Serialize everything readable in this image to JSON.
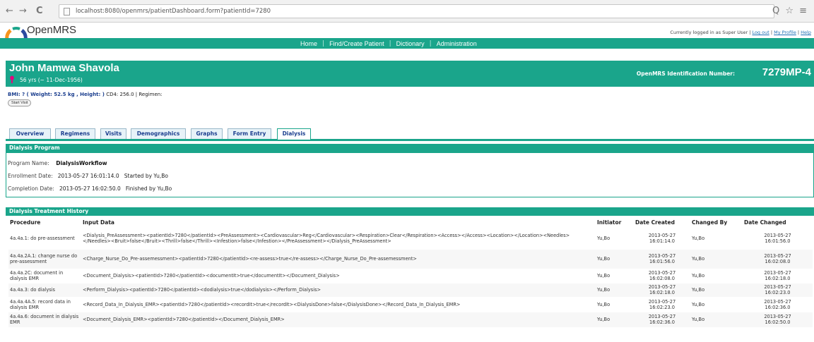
{
  "browser": {
    "url": "localhost:8080/openmrs/patientDashboard.form?patientId=7280",
    "back_glyph": "←",
    "forward_glyph": "→",
    "reload_glyph": "C",
    "right_glyphs": "Q ☆ ≡"
  },
  "app": {
    "logo_text": "OpenMRS",
    "user_prefix": "Currently logged in as Super User",
    "logout": "Log out",
    "my_profile": "My Profile",
    "help": "Help",
    "menu": [
      "Home",
      "Find/Create Patient",
      "Dictionary",
      "Administration"
    ],
    "menu_sep": "|",
    "accent": "#1aa58b"
  },
  "patient": {
    "name": "John Mamwa Shavola",
    "age": "56 yrs (~ 11-Dec-1956)",
    "id_label": "OpenMRS Identification Number:",
    "id_value": "7279MP-4",
    "bmi_label": "BMI: ?",
    "weight_height": "( Weight: 52.5 kg , Height: )",
    "cd4": "CD4: 256.0",
    "regimen": "| Regimen:",
    "start_visit": "Start Visit"
  },
  "tabs": [
    "Overview",
    "Regimens",
    "Visits",
    "Demographics",
    "Graphs",
    "Form Entry",
    "Dialysis"
  ],
  "program": {
    "title": "Dialysis Program",
    "name_label": "Program Name:",
    "name_value": "DialysisWorkflow",
    "enroll_label": "Enrollment Date:",
    "enroll_value": "2013-05-27 16:01:14.0",
    "enroll_by": "Started by Yu,Bo",
    "complete_label": "Completion Date:",
    "complete_value": "2013-05-27 16:02:50.0",
    "complete_by": "Finished by Yu,Bo"
  },
  "history": {
    "title": "Dialysis Treatment History",
    "columns": [
      "Procedure",
      "Input Data",
      "Initiator",
      "Date Created",
      "Changed By",
      "Date Changed"
    ],
    "rows": [
      {
        "procedure": "4a.4a.1: do pre-assessment",
        "input": "<Dialysis_PreAssessment><patientId>7280</patientId><PreAssessment><Cardiovascular>Reg</Cardiovascular><Respiration>Clear</Respiration><Access></Access><Location></Location><Needles></Needles><Bruit>false</Bruit><Thrill>false</Thrill><Infestion>false</Infestion></PreAssessment></Dialysis_PreAssessment>",
        "initiator": "Yu,Bo",
        "created_date": "2013-05-27",
        "created_time": "16:01:14.0",
        "changed_by": "Yu,Bo",
        "changed_date": "2013-05-27",
        "changed_time": "16:01:56.0"
      },
      {
        "procedure": "4a.4a.2A.1: change nurse do pre-assessment",
        "input": "<Charge_Nurse_Do_Pre-assemessment><patientId>7280</patientId><re-assess>true</re-assess></Charge_Nurse_Do_Pre-assemessment>",
        "initiator": "Yu,Bo",
        "created_date": "2013-05-27",
        "created_time": "16:01:56.0",
        "changed_by": "Yu,Bo",
        "changed_date": "2013-05-27",
        "changed_time": "16:02:08.0"
      },
      {
        "procedure": "4a.4a.2C: document in dialysis EMR",
        "input": "<Document_Dialysis><patientId>7280</patientId><documentIt>true</documentIt></Document_Dialysis>",
        "initiator": "Yu,Bo",
        "created_date": "2013-05-27",
        "created_time": "16:02:08.0",
        "changed_by": "Yu,Bo",
        "changed_date": "2013-05-27",
        "changed_time": "16:02:18.0"
      },
      {
        "procedure": "4a.4a.3: do dialysis",
        "input": "<Perform_Dialysis><patientId>7280</patientId><dodialysis>true</dodialysis></Perform_Dialysis>",
        "initiator": "Yu,Bo",
        "created_date": "2013-05-27",
        "created_time": "16:02:18.0",
        "changed_by": "Yu,Bo",
        "changed_date": "2013-05-27",
        "changed_time": "16:02:23.0"
      },
      {
        "procedure": "4a.4a.4A.5: record data in dialysis EMR",
        "input": "<Record_Data_In_Dialysis_EMR><patientId>7280</patientId><recordIt>true</recordIt><DialysisDone>false</DialysisDone></Record_Data_In_Dialysis_EMR>",
        "initiator": "Yu,Bo",
        "created_date": "2013-05-27",
        "created_time": "16:02:23.0",
        "changed_by": "Yu,Bo",
        "changed_date": "2013-05-27",
        "changed_time": "16:02:36.0"
      },
      {
        "procedure": "4a.4a.6: document in dialysis EMR",
        "input": "<Document_Dialysis_EMR><patientId>7280</patientId></Document_Dialysis_EMR>",
        "initiator": "Yu,Bo",
        "created_date": "2013-05-27",
        "created_time": "16:02:36.0",
        "changed_by": "Yu,Bo",
        "changed_date": "2013-05-27",
        "changed_time": "16:02:50.0"
      }
    ]
  }
}
